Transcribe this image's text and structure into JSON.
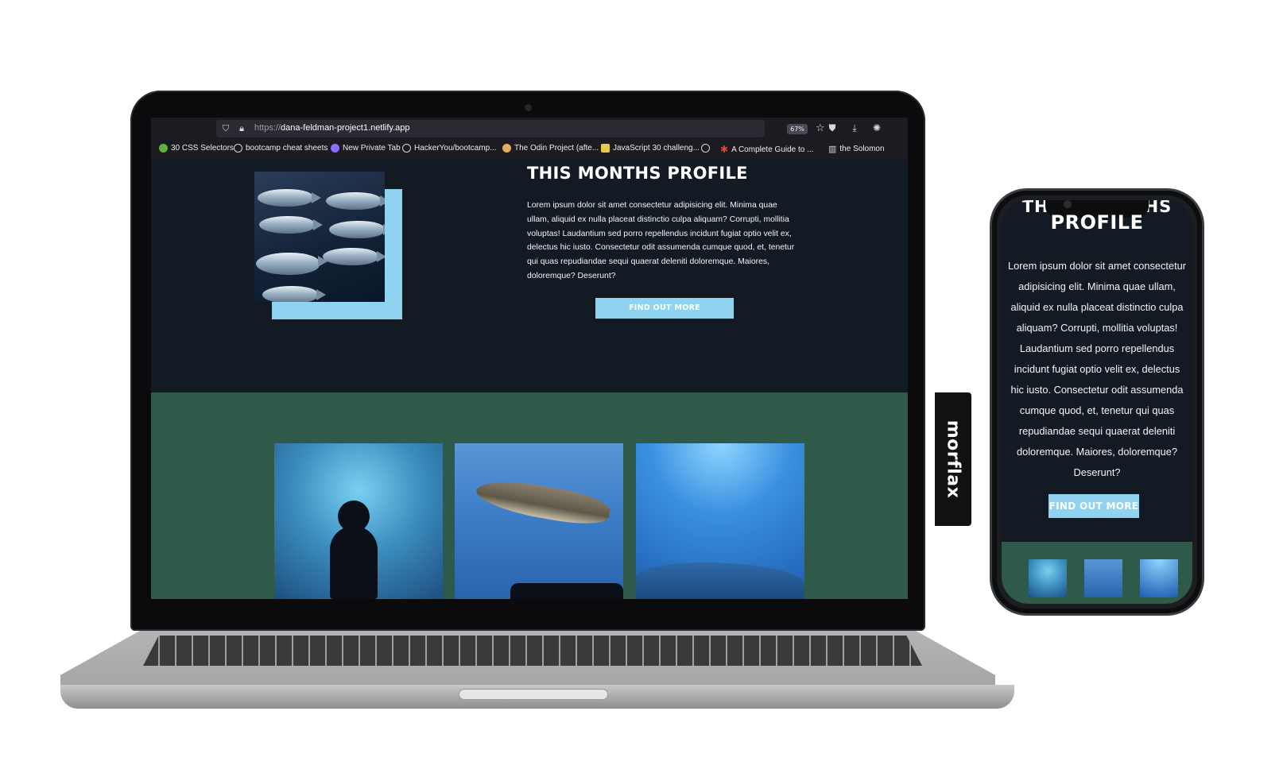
{
  "browser": {
    "url_protocol": "https://",
    "url_host": "dana-feldman-project1.netlify.app",
    "zoom": "67%"
  },
  "bookmarks": [
    {
      "label": "30 CSS Selectors",
      "icon": "leaf-icon",
      "color": "#5fb03a"
    },
    {
      "label": "bootcamp cheat sheets",
      "icon": "github-icon",
      "color": "#d8d8dc"
    },
    {
      "label": "New Private Tab",
      "icon": "private-mask-icon",
      "color": "#8a6cff"
    },
    {
      "label": "HackerYou/bootcamp...",
      "icon": "github-icon",
      "color": "#d8d8dc"
    },
    {
      "label": "The Odin Project (afte...",
      "icon": "odin-icon",
      "color": "#e0b060"
    },
    {
      "label": "JavaScript 30 challeng...",
      "icon": "js30-icon",
      "color": "#e6c84a"
    },
    {
      "label": "",
      "icon": "github-icon",
      "color": "#d8d8dc"
    },
    {
      "label": "A Complete Guide to ...",
      "icon": "asterisk-icon",
      "color": "#e0443c"
    },
    {
      "label": "the Solomon",
      "icon": "bookmark-page-icon",
      "color": "#d8d8dc"
    }
  ],
  "profile": {
    "title": "THIS MONTHS PROFILE",
    "body": "Lorem ipsum dolor sit amet consectetur adipisicing elit. Minima quae ullam, aliquid ex nulla placeat distinctio culpa aliquam? Corrupti, mollitia voluptas! Laudantium sed porro repellendus incidunt fugiat optio velit ex, delectus hic iusto. Consectetur odit assumenda cumque quod, et, tenetur qui quas repudiandae sequi quaerat deleniti doloremque. Maiores, doloremque? Deserunt?",
    "button": "FIND OUT MORE"
  },
  "mobile": {
    "title_partial_left": "TH",
    "title_partial_right": "HS",
    "title": "PROFILE",
    "body": "Lorem ipsum dolor sit amet consectetur adipisicing elit. Minima quae ullam, aliquid ex nulla placeat distinctio culpa aliquam? Corrupti, mollitia voluptas! Laudantium sed porro repellendus incidunt fugiat optio velit ex, delectus hic iusto. Consectetur odit assumenda cumque quod, et, tenetur qui quas repudiandae sequi quaerat deleniti doloremque. Maiores, doloremque? Deserunt?",
    "button": "FIND OUT MORE"
  },
  "sidebar_tab": "morflax",
  "colors": {
    "dark_bg": "#141a24",
    "accent": "#8fd3f0",
    "green": "#2f5a4a"
  }
}
